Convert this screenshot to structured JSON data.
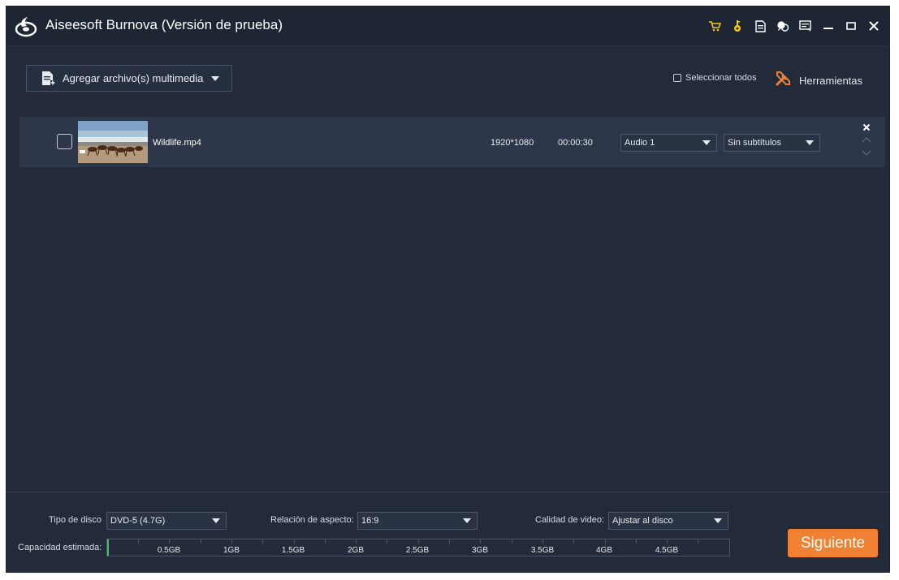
{
  "app": {
    "title": "Aiseesoft Burnova (Versión de prueba)",
    "accent_color": "#f08132",
    "title_icons": [
      "cart-icon",
      "key-icon",
      "document-icon",
      "feedback-icon",
      "menu-icon",
      "minimize-icon",
      "maximize-icon",
      "close-icon"
    ]
  },
  "toolbar": {
    "add_media_label": "Agregar archivo(s) multimedia",
    "select_all_label": "Seleccionar todos",
    "tools_label": "Herramientas"
  },
  "files": [
    {
      "name": "Wildlife.mp4",
      "resolution": "1920*1080",
      "duration": "00:00:30",
      "audio": "Audio 1",
      "subtitles": "Sin subtítulos"
    }
  ],
  "bottom": {
    "disc_type_label": "Tipo de disco",
    "disc_type_value": "DVD-5 (4.7G)",
    "aspect_label": "Relación de aspecto:",
    "aspect_value": "16:9",
    "quality_label": "Calidad de video:",
    "quality_value": "Ajustar al disco",
    "capacity_label": "Capacidad estimada:",
    "capacity_used_fraction": 0.003,
    "capacity_scale": [
      "0.5GB",
      "1GB",
      "1.5GB",
      "2GB",
      "2.5GB",
      "3GB",
      "3.5GB",
      "4GB",
      "4.5GB"
    ],
    "next_label": "Siguiente"
  }
}
